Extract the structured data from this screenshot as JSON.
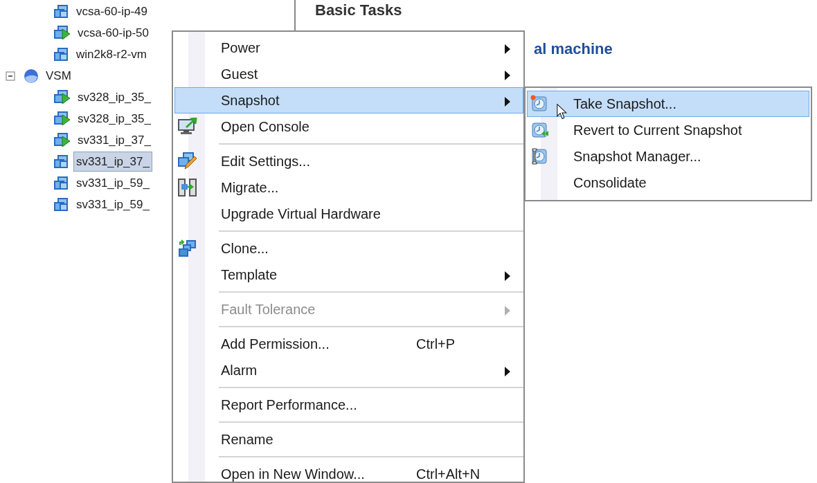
{
  "tree": [
    {
      "label": "vcsa-60-ip-49",
      "kind": "vm",
      "powered_on": false,
      "selected": false
    },
    {
      "label": "vcsa-60-ip-50",
      "kind": "vm",
      "powered_on": true,
      "selected": false
    },
    {
      "label": "win2k8-r2-vm",
      "kind": "vm",
      "powered_on": false,
      "selected": false
    },
    {
      "label": "VSM",
      "kind": "datacenter",
      "expanded": true,
      "selected": false,
      "children": [
        {
          "label": "sv328_ip_35_",
          "kind": "vm",
          "powered_on": true,
          "selected": false
        },
        {
          "label": "sv328_ip_35_",
          "kind": "vm",
          "powered_on": true,
          "selected": false
        },
        {
          "label": "sv331_ip_37_",
          "kind": "vm",
          "powered_on": true,
          "selected": false
        },
        {
          "label": "sv331_ip_37_",
          "kind": "vm",
          "powered_on": false,
          "selected": true
        },
        {
          "label": "sv331_ip_59_",
          "kind": "vm",
          "powered_on": false,
          "selected": false
        },
        {
          "label": "sv331_ip_59_",
          "kind": "vm",
          "powered_on": false,
          "selected": false
        }
      ]
    }
  ],
  "tasks": {
    "heading": "Basic Tasks",
    "link": "al machine"
  },
  "context_menu": [
    {
      "label": "Power",
      "has_submenu": true,
      "selected": false,
      "disabled": false,
      "separator_above": false
    },
    {
      "label": "Guest",
      "has_submenu": true,
      "selected": false,
      "disabled": false,
      "separator_above": false
    },
    {
      "label": "Snapshot",
      "has_submenu": true,
      "selected": true,
      "disabled": false,
      "separator_above": false
    },
    {
      "label": "Open Console",
      "kind": "console",
      "has_submenu": false,
      "selected": false,
      "disabled": false,
      "separator_above": false
    },
    {
      "label": "Edit Settings...",
      "kind": "edit",
      "has_submenu": false,
      "selected": false,
      "disabled": false,
      "separator_above": true
    },
    {
      "label": "Migrate...",
      "kind": "migrate",
      "has_submenu": false,
      "selected": false,
      "disabled": false,
      "separator_above": false
    },
    {
      "label": "Upgrade Virtual Hardware",
      "has_submenu": false,
      "selected": false,
      "disabled": false,
      "separator_above": false
    },
    {
      "label": "Clone...",
      "kind": "clone",
      "has_submenu": false,
      "selected": false,
      "disabled": false,
      "separator_above": true
    },
    {
      "label": "Template",
      "has_submenu": true,
      "selected": false,
      "disabled": false,
      "separator_above": false
    },
    {
      "label": "Fault Tolerance",
      "has_submenu": true,
      "selected": false,
      "disabled": true,
      "separator_above": true
    },
    {
      "label": "Add Permission...",
      "shortcut": "Ctrl+P",
      "has_submenu": false,
      "selected": false,
      "disabled": false,
      "separator_above": true
    },
    {
      "label": "Alarm",
      "has_submenu": true,
      "selected": false,
      "disabled": false,
      "separator_above": false
    },
    {
      "label": "Report Performance...",
      "has_submenu": false,
      "selected": false,
      "disabled": false,
      "separator_above": true
    },
    {
      "label": "Rename",
      "has_submenu": false,
      "selected": false,
      "disabled": false,
      "separator_above": true
    },
    {
      "label": "Open in New Window...",
      "shortcut": "Ctrl+Alt+N",
      "has_submenu": false,
      "selected": false,
      "disabled": false,
      "separator_above": true
    }
  ],
  "submenu": [
    {
      "label": "Take Snapshot...",
      "kind": "take",
      "selected": true
    },
    {
      "label": "Revert to Current Snapshot",
      "kind": "revert",
      "selected": false
    },
    {
      "label": "Snapshot Manager...",
      "kind": "manager",
      "selected": false
    },
    {
      "label": "Consolidate",
      "selected": false
    }
  ]
}
